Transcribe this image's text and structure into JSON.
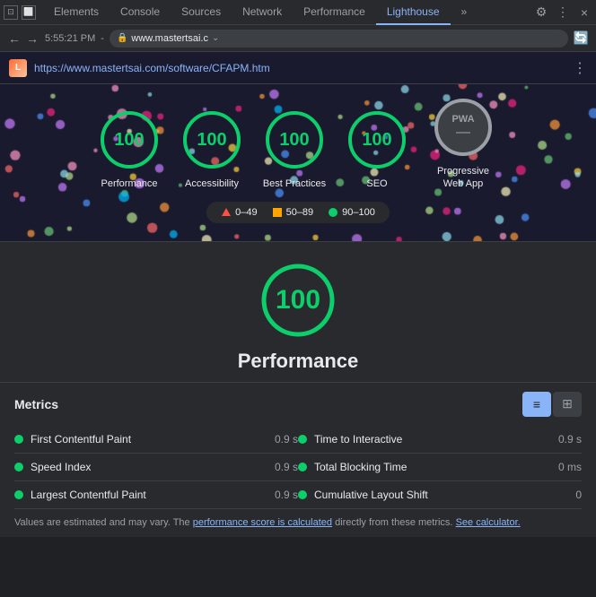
{
  "devtools": {
    "tabs": [
      {
        "label": "Elements"
      },
      {
        "label": "Console"
      },
      {
        "label": "Sources"
      },
      {
        "label": "Network"
      },
      {
        "label": "Performance"
      },
      {
        "label": "Lighthouse",
        "active": true
      }
    ],
    "more_label": "»",
    "settings_icon": "⚙",
    "more_icon": "⋮",
    "close_icon": "×"
  },
  "address_bar": {
    "back_icon": "←",
    "forward_icon": "→",
    "time": "5:55:21 PM",
    "url": "www.mastertsai.c",
    "refresh_icon": "↻"
  },
  "site_url": {
    "url": "https://www.mastertsai.com/software/CFAPM.htm",
    "menu_icon": "⋮"
  },
  "scores": {
    "items": [
      {
        "label": "Performance",
        "score": "100",
        "type": "green"
      },
      {
        "label": "Accessibility",
        "score": "100",
        "type": "green"
      },
      {
        "label": "Best Practices",
        "score": "100",
        "type": "green"
      },
      {
        "label": "SEO",
        "score": "100",
        "type": "green"
      },
      {
        "label": "Progressive Web App",
        "score": "PWA",
        "type": "pwa",
        "icon": "—"
      }
    ],
    "legend": {
      "items": [
        {
          "icon": "triangle",
          "range": "0–49"
        },
        {
          "icon": "square",
          "range": "50–89"
        },
        {
          "icon": "circle",
          "range": "90–100"
        }
      ]
    }
  },
  "performance": {
    "score": "100",
    "title": "Performance"
  },
  "metrics": {
    "title": "Metrics",
    "view_list_icon": "≡",
    "view_grid_icon": "⊞",
    "items_left": [
      {
        "name": "First Contentful Paint",
        "value": "0.9 s"
      },
      {
        "name": "Speed Index",
        "value": "0.9 s"
      },
      {
        "name": "Largest Contentful Paint",
        "value": "0.9 s"
      }
    ],
    "items_right": [
      {
        "name": "Time to Interactive",
        "value": "0.9 s"
      },
      {
        "name": "Total Blocking Time",
        "value": "0 ms"
      },
      {
        "name": "Cumulative Layout Shift",
        "value": "0"
      }
    ]
  },
  "footer": {
    "text_before": "Values are estimated and may vary. The ",
    "link1": "performance score is calculated",
    "text_middle": " directly from these metrics. ",
    "link2": "See calculator."
  }
}
